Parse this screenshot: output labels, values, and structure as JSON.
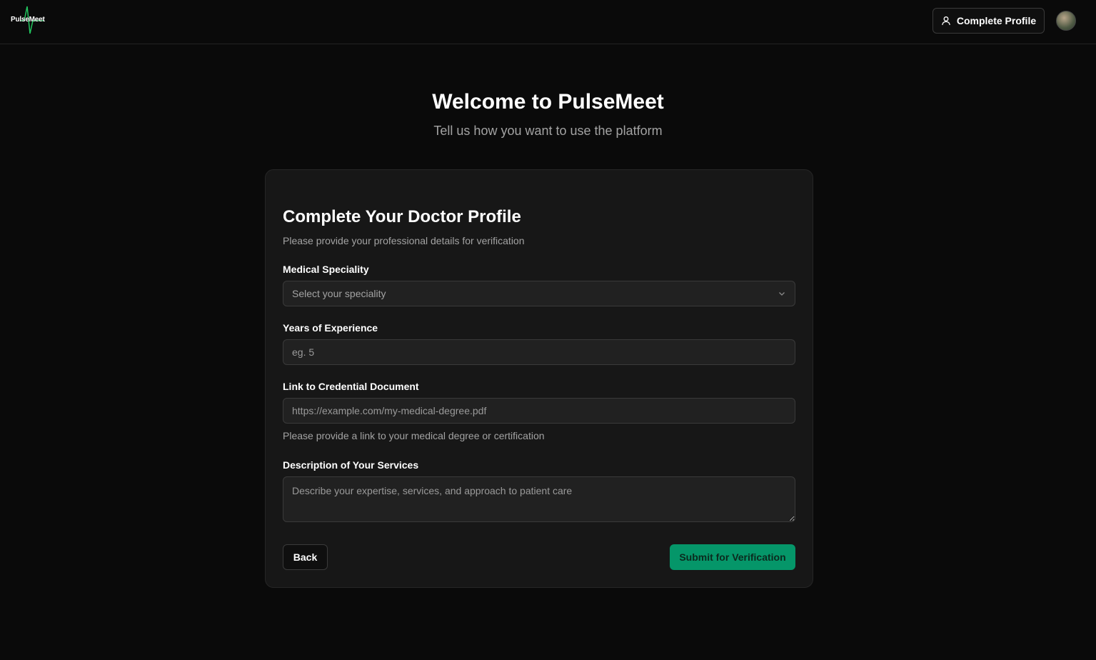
{
  "header": {
    "logo_text": "PulseMeet",
    "profile_button_label": "Complete Profile",
    "accent_color": "#22c55e"
  },
  "hero": {
    "title": "Welcome to PulseMeet",
    "subtitle": "Tell us how you want to use the platform"
  },
  "form": {
    "title": "Complete Your Doctor Profile",
    "description": "Please provide your professional details for verification",
    "speciality": {
      "label": "Medical Speciality",
      "selected_value": "Select your speciality"
    },
    "experience": {
      "label": "Years of Experience",
      "placeholder": "eg. 5"
    },
    "credential": {
      "label": "Link to Credential Document",
      "placeholder": "https://example.com/my-medical-degree.pdf",
      "hint": "Please provide a link to your medical degree or certification"
    },
    "description_field": {
      "label": "Description of Your Services",
      "placeholder": "Describe your expertise, services, and approach to patient care"
    },
    "back_label": "Back",
    "submit_label": "Submit for Verification",
    "submit_color": "#059669"
  }
}
